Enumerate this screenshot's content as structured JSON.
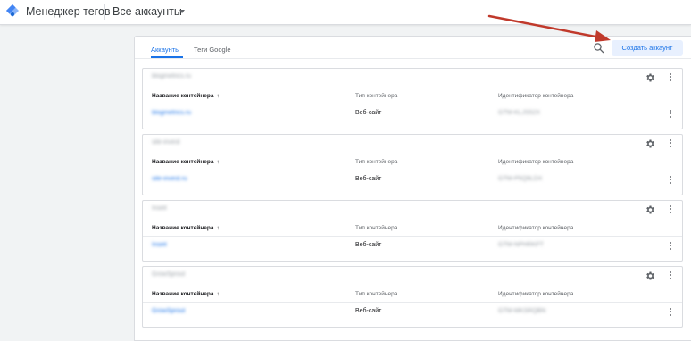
{
  "header": {
    "app_title": "Менеджер тегов",
    "account_selector": "Все аккаунты"
  },
  "tabs": [
    {
      "label": "Аккаунты",
      "active": true
    },
    {
      "label": "Теги Google",
      "active": false
    }
  ],
  "toolbar": {
    "create_account_label": "Создать аккаунт"
  },
  "table_headers": {
    "name": "Название контейнера",
    "type": "Тип контейнера",
    "id": "Идентификатор контейнера"
  },
  "accounts": [
    {
      "name": "blogmetrics.ru",
      "container_name": "blogmetrics.ru",
      "container_type": "Веб-сайт",
      "container_id": "GTM-KLJS52X"
    },
    {
      "name": "site-invest",
      "container_name": "site-invest.ru",
      "container_id": "GTM-P5Q9LDX",
      "container_type": "Веб-сайт"
    },
    {
      "name": "Inseit",
      "container_name": "Inseit",
      "container_type": "Веб-сайт",
      "container_id": "GTM-NPHRKFT"
    },
    {
      "name": "GrowSprout",
      "container_name": "GrowSprout",
      "container_type": "Веб-сайт",
      "container_id": "GTM-MKSRQBN"
    }
  ],
  "colors": {
    "accent": "#1a73e8",
    "annotation_arrow": "#c0392b"
  },
  "icons": {
    "logo": "gtm-logo-icon",
    "caret": "chevron-down-icon",
    "search": "search-icon",
    "settings": "gear-icon",
    "more": "more-vert-icon",
    "sort": "arrow-upward-icon"
  }
}
